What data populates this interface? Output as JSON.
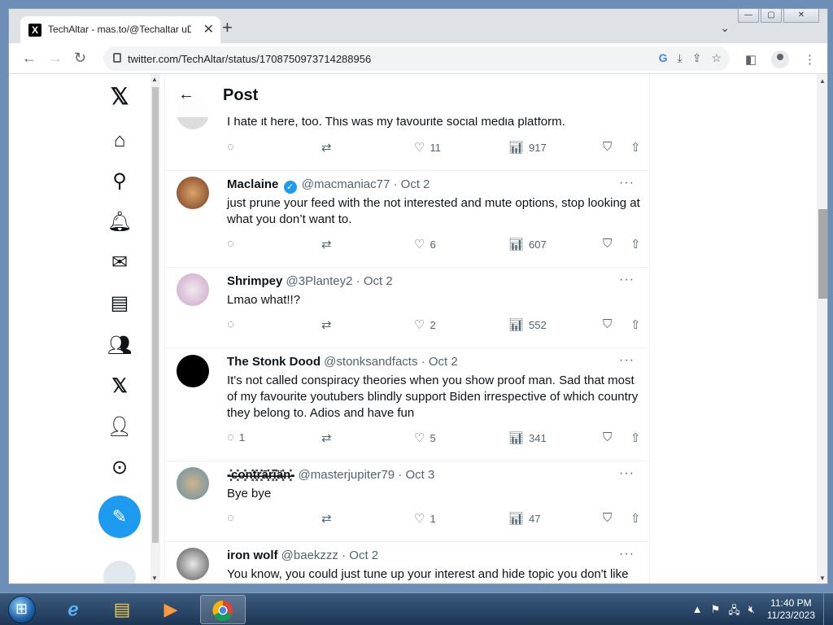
{
  "browser": {
    "tab_title": "TechAltar - mas.to/@Techaltar uD",
    "tab_favicon": "X",
    "url": "twitter.com/TechAltar/status/1708750973714288956",
    "new_tab": "+",
    "close_tab": "✕",
    "tab_search": "⌄",
    "win_min": "—",
    "win_max": "▢",
    "win_close": "✕"
  },
  "post_header": {
    "back_arrow": "←",
    "title": "Post"
  },
  "replies": [
    {
      "name": "",
      "handle": "",
      "date": "",
      "text": "I hate it here, too. This was my favourite social media platform.",
      "comments": "",
      "likes": "11",
      "views": "917"
    },
    {
      "name": "Maclaine",
      "verified": true,
      "handle": "@macmaniac77",
      "date": "Oct 2",
      "text": "just prune your feed with the not interested and mute options, stop looking at what you don’t want to.",
      "comments": "",
      "likes": "6",
      "views": "607"
    },
    {
      "name": "Shrimpey",
      "handle": "@3Plantey2",
      "date": "Oct 2",
      "text": "Lmao what!!?",
      "comments": "",
      "likes": "2",
      "views": "552"
    },
    {
      "name": "The Stonk Dood",
      "handle": "@stonksandfacts",
      "date": "Oct 2",
      "text": "It's not called conspiracy theories when you show proof man. Sad that most of my favourite youtubers blindly support Biden irrespective of which country they belong to. Adios and have fun",
      "comments": "1",
      "likes": "5",
      "views": "341"
    },
    {
      "name": "-̶̶͓̽c̶̶͓̽o̶̶͓̽n̶̶͓̽t̶̶͓̽r̶̶͓̽ā̶̶͓̽r̶̶͓̽i̶̶͓̽ä̶̶͓̽n̶̶͓̽-",
      "handle": "@masterjupiter79",
      "date": "Oct 3",
      "text": "Bye bye",
      "comments": "",
      "likes": "1",
      "views": "47"
    },
    {
      "name": "iron wolf",
      "handle": "@baekzzz",
      "date": "Oct 2",
      "text": "You know, you could just tune up your interest and hide topic you don't like",
      "comments": "",
      "likes": "",
      "views": ""
    }
  ],
  "taskbar": {
    "time": "11:40 PM",
    "date": "11/23/2023"
  },
  "colors": {
    "accent": "#1d9bf0",
    "text": "#0f1419",
    "muted": "#536471"
  }
}
